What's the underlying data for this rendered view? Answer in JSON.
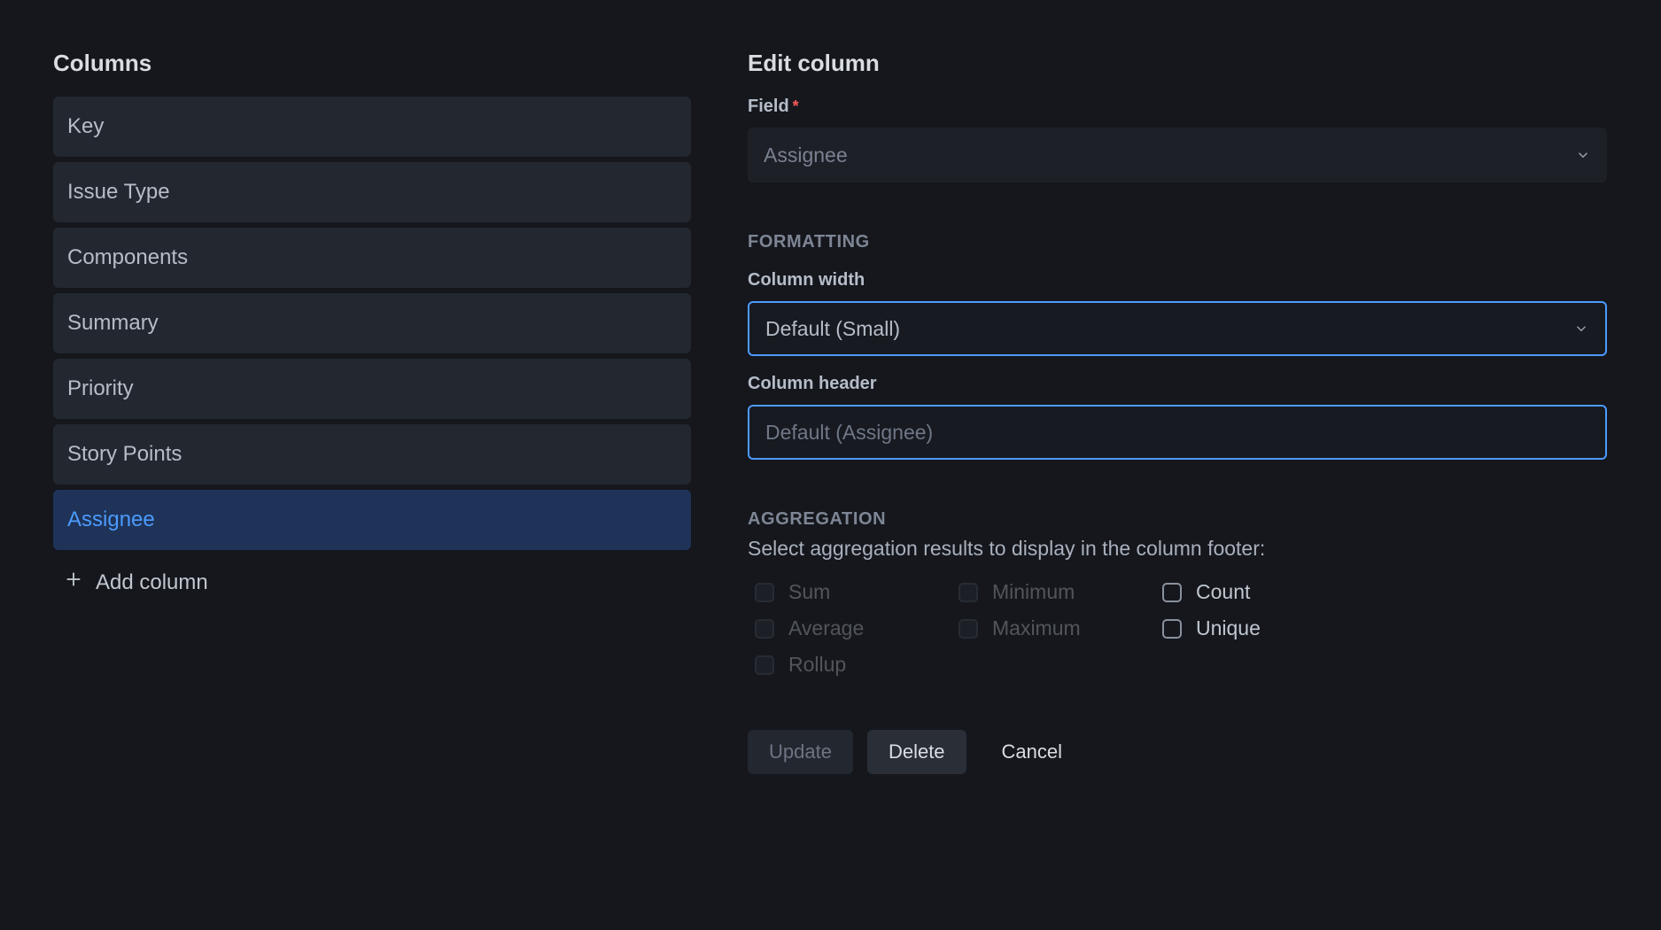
{
  "left": {
    "title": "Columns",
    "items": [
      {
        "label": "Key",
        "selected": false
      },
      {
        "label": "Issue Type",
        "selected": false
      },
      {
        "label": "Components",
        "selected": false
      },
      {
        "label": "Summary",
        "selected": false
      },
      {
        "label": "Priority",
        "selected": false
      },
      {
        "label": "Story Points",
        "selected": false
      },
      {
        "label": "Assignee",
        "selected": true
      }
    ],
    "add_label": "Add column"
  },
  "right": {
    "title": "Edit column",
    "field_label": "Field",
    "field_required": "*",
    "field_value": "Assignee",
    "formatting_header": "FORMATTING",
    "width_label": "Column width",
    "width_value": "Default (Small)",
    "header_label": "Column header",
    "header_placeholder": "Default (Assignee)",
    "aggregation_header": "AGGREGATION",
    "aggregation_desc": "Select aggregation results to display in the column footer:",
    "agg_items": [
      {
        "label": "Sum",
        "enabled": false
      },
      {
        "label": "Minimum",
        "enabled": false
      },
      {
        "label": "Count",
        "enabled": true
      },
      {
        "label": "Average",
        "enabled": false
      },
      {
        "label": "Maximum",
        "enabled": false
      },
      {
        "label": "Unique",
        "enabled": true
      },
      {
        "label": "Rollup",
        "enabled": false
      }
    ],
    "buttons": {
      "update": "Update",
      "delete": "Delete",
      "cancel": "Cancel"
    }
  }
}
